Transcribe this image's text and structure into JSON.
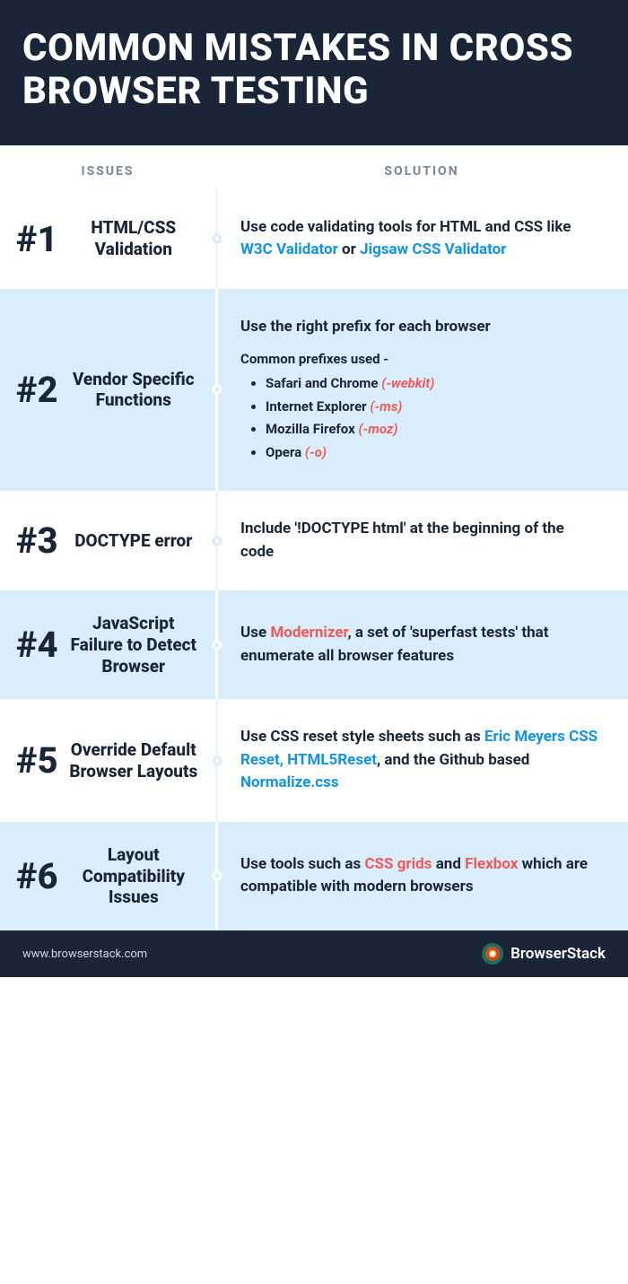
{
  "title": "COMMON MISTAKES IN CROSS BROWSER TESTING",
  "columns": {
    "issues": "ISSUES",
    "solution": "SOLUTION"
  },
  "rows": [
    {
      "num": "#1",
      "issue": "HTML/CSS Validation",
      "solution": {
        "pre": "Use code validating tools for HTML and CSS like ",
        "link1": "W3C Validator",
        "mid": " or ",
        "link2": "Jigsaw CSS Validator"
      }
    },
    {
      "num": "#2",
      "issue": "Vendor Specific Functions",
      "solution": {
        "text": "Use the right prefix for each browser"
      },
      "subhead": "Common prefixes used -",
      "bullets": [
        {
          "label": "Safari and Chrome ",
          "suffix": "(-webkit)"
        },
        {
          "label": "Internet Explorer ",
          "suffix": "(-ms)"
        },
        {
          "label": "Mozilla Firefox ",
          "suffix": "(-moz)"
        },
        {
          "label": "Opera ",
          "suffix": "(-o)"
        }
      ]
    },
    {
      "num": "#3",
      "issue": "DOCTYPE error",
      "solution": {
        "text": "Include '!DOCTYPE html' at the beginning of the code"
      }
    },
    {
      "num": "#4",
      "issue": "JavaScript Failure to Detect Browser",
      "solution": {
        "pre": "Use ",
        "red": "Modernizer",
        "post": ", a set of 'superfast tests' that enumerate all browser features"
      }
    },
    {
      "num": "#5",
      "issue": "Override Default Browser Layouts",
      "solution": {
        "pre": "Use CSS reset style sheets such as ",
        "link1": "Eric Meyers CSS Reset, HTML5Reset",
        "mid": ", and the Github based ",
        "link2": "Normalize.css"
      }
    },
    {
      "num": "#6",
      "issue": "Layout Compatibility Issues",
      "solution": {
        "pre": "Use tools such as ",
        "red1": "CSS grids",
        "mid": " and ",
        "red2": "Flexbox",
        "post": " which are compatible with modern browsers"
      }
    }
  ],
  "footer": {
    "site": "www.browserstack.com",
    "brand": "BrowserStack"
  }
}
